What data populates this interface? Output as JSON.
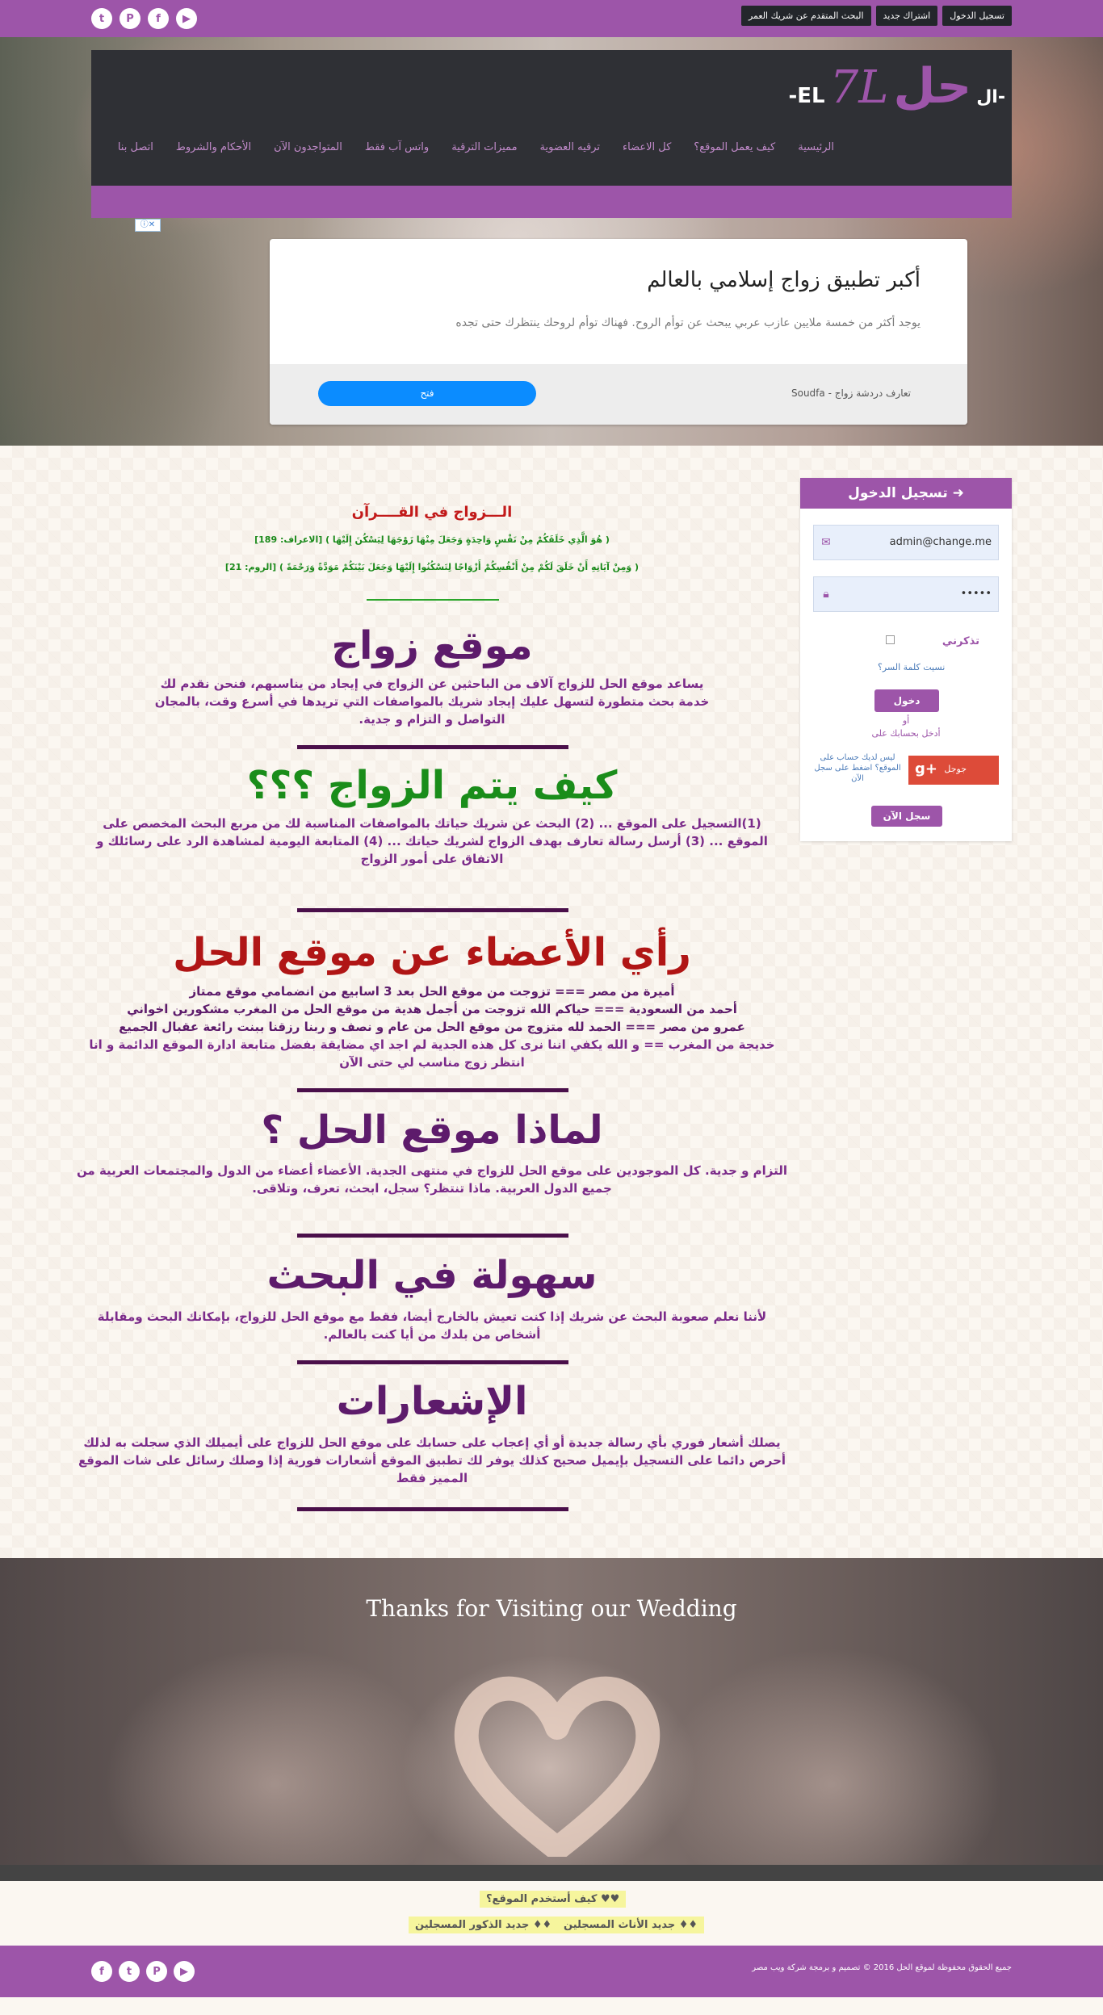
{
  "topbar": {
    "buttons": [
      "تسجيل الدخول",
      "اشتراك جديد",
      "البحث المتقدم عن شريك العمر"
    ],
    "social": [
      {
        "icon": "youtube-icon",
        "glyph": "▶"
      },
      {
        "icon": "facebook-icon",
        "glyph": "f"
      },
      {
        "icon": "pinterest-icon",
        "glyph": "P"
      },
      {
        "icon": "twitter-icon",
        "glyph": "t"
      }
    ]
  },
  "header": {
    "logo": {
      "al": "ال-",
      "hal": "حل",
      "sevenl": "7L",
      "el": "-EL"
    },
    "menu": [
      "الرئيسية",
      "كيف يعمل الموقع؟",
      "كل الاعضاء",
      "ترقيه العضوية",
      "مميزات الترقية",
      "واتس آب فقط",
      "المتواجدون الآن",
      "الأحكام والشروط",
      "اتصل بنا"
    ]
  },
  "ad": {
    "flag": "ⓘ✕",
    "title": "أكبر تطبيق زواج إسلامي بالعالم",
    "text": "يوجد أكثر من خمسة ملايين عازب عربي يبحث عن توأم الروح. فهناك توأم لروحك ينتظرك حتى تجده",
    "source": "تعارف دردشة زواج - Soudfa",
    "button": "فتح"
  },
  "login": {
    "title": "تسجيل الدخول",
    "email": "admin@change.me",
    "password": "•••••",
    "remember": "تذكرني",
    "forgot": "نسيت كلمة السر؟",
    "login_btn": "دخول",
    "or": "أو",
    "with_account": "أدخل بحسابك على",
    "google_label": "جوجل",
    "no_account": "ليس لديك حساب على الموقع؟ اضغط على سجل الآن",
    "register_btn": "سجل الآن"
  },
  "quran": {
    "title": "الـــزواج في القــــرآن",
    "verse1": "( هُوَ الَّذِي خَلَقَكُمْ مِنْ نَفْسٍ وَاحِدَةٍ وَجَعَلَ مِنْهَا زَوْجَهَا لِيَسْكُنَ إِلَيْهَا ) [الاعراف: 189]",
    "verse2": "( وَمِنْ آيَاتِهِ أَنْ خَلَقَ لَكُمْ مِنْ أَنْفُسِكُمْ أَزْوَاجًا لِتَسْكُنُوا إِلَيْهَا وَجَعَلَ بَيْنَكُمْ مَوَدَّةً وَرَحْمَةً ) [الروم: 21]"
  },
  "sections": {
    "s1": {
      "title": "موقع زواج",
      "text": "يساعد موقع الحل للزواج آلاف من الباحثين عن الزواج في إيجاد من يناسبهم، فنحن نقدم لك خدمة بحث متطورة لتسهل عليك إيجاد شريك بالمواصفات التي تريدها في أسرع وقت، بالمجان التواصل و التزام و جدية."
    },
    "s2": {
      "title": "كيف يتم الزواج ؟؟؟",
      "text": "(1)التسجيل على الموقع ... (2) البحث عن شريك حياتك بالمواصفات المناسبة لك من مربع البحث المخصص على الموقع ... (3) أرسل رسالة تعارف بهدف الزواج لشريك حياتك ... (4) المتابعة اليومية لمشاهدة الرد على رسائلك و الاتفاق على أمور الزواج"
    },
    "s3": {
      "title": "رأي الأعضاء عن موقع الحل",
      "lines": [
        "أميرة من مصر === تزوجت من موقع الحل بعد 3 اسابيع من انضمامي موقع ممتاز",
        "أحمد من السعودية === حياكم الله تزوجت من أجمل هدية من موقع الحل من المغرب مشكورين اخواني",
        "عمرو من مصر === الحمد لله متزوج من موقع الحل من عام و نصف و ربنا رزقنا ببنت رائعة عقبال الجميع",
        "خديجة من المغرب == و الله يكفي اننا نرى كل هذه الجدية لم اجد اي مضايقة بفضل متابعة ادارة الموقع الدائمة و انا انتظر زوج مناسب لي حتى الآن"
      ]
    },
    "s4": {
      "title": "لماذا موقع الحل ؟",
      "text": "التزام و جدية. كل الموجودين على موقع الحل للزواج في منتهى الجدية. الأعضاء أعضاء من الدول والمجتمعات العربية من جميع الدول العربية. ماذا تنتظر؟ سجل، ابحث، تعرف، وتلاقى."
    },
    "s5": {
      "title": "سهولة في البحث",
      "text": "لأننا نعلم صعوبة البحث عن شريك إذا كنت تعيش بالخارج أيضا، فقط مع موقع الحل للزواج، بإمكانك البحث ومقابلة أشخاص من بلدك من أيا كنت بالعالم."
    },
    "s6": {
      "title": "الإشعارات",
      "text": "يصلك أشعار فوري بأي رسالة جديدة أو أي إعجاب على حسابك على موقع الحل للزواج على أيميلك الذي سجلت به لذلك أحرص دائما على التسجيل بإيميل صحيح كذلك يوفر لك تطبيق الموقع أشعارات فورية إذا وصلك رسائل على شات الموقع المميز فقط"
    }
  },
  "thanks": {
    "title": "Thanks for Visiting our Wedding"
  },
  "links": {
    "how": "♥♥ كيف أستخدم الموقع؟",
    "new_female": "♦♦ جديد الأناث المسجلين",
    "new_male": "♦♦ جديد الذكور المسجلين"
  },
  "footer": {
    "copyright": "جميع الحقوق محفوظة لموقع الحل 2016 © تصميم و برمجة شركة ويب مصر"
  }
}
